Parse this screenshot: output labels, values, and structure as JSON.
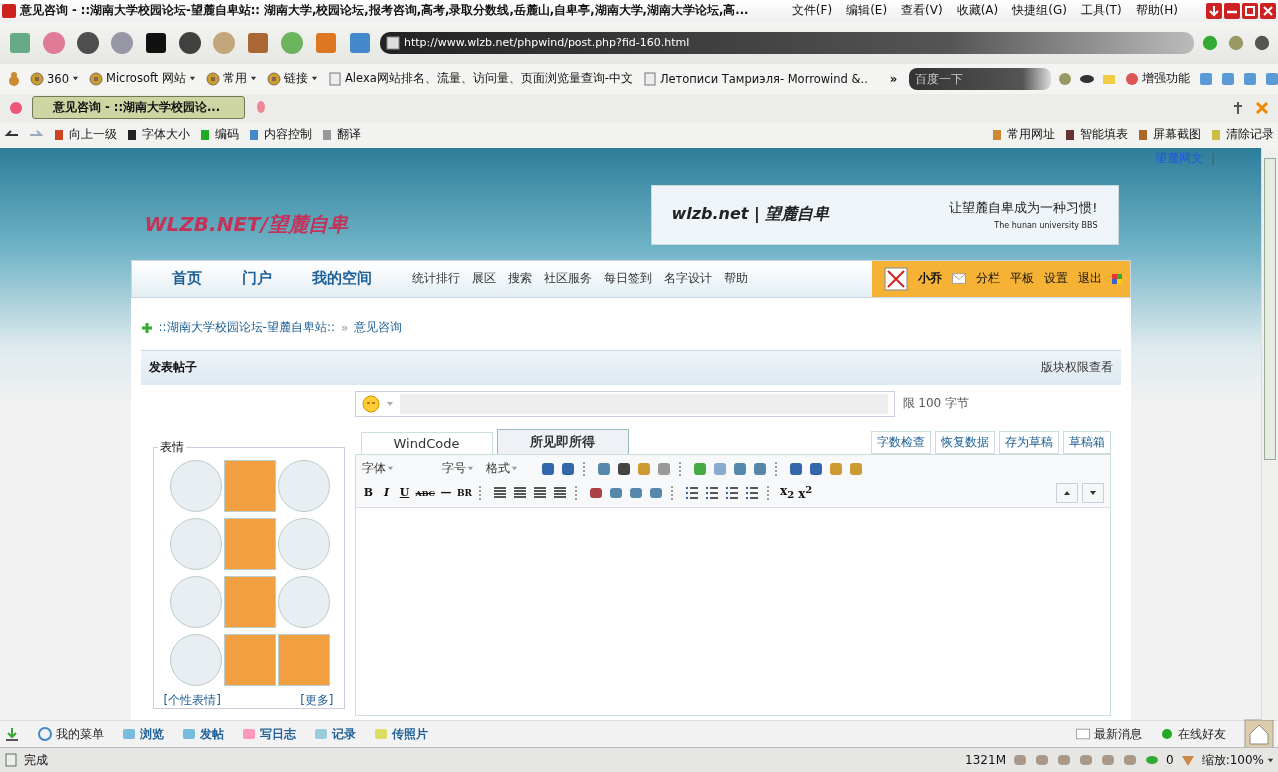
{
  "window": {
    "title": "意见咨询 - ::湖南大学校园论坛-望麓自卑站:: 湖南大学,校园论坛,报考咨询,高考,录取分数线,岳麓山,自卑亭,湖南大学,湖南大学论坛,高...",
    "menu": [
      "文件(F)",
      "编辑(E)",
      "查看(V)",
      "收藏(A)",
      "快捷组(G)",
      "工具(T)",
      "帮助(H)"
    ]
  },
  "address": {
    "url": "http://www.wlzb.net/phpwind/post.php?fid-160.html"
  },
  "bookmarks": [
    {
      "label": "360",
      "dropdown": true
    },
    {
      "label": "Microsoft 网站",
      "dropdown": true
    },
    {
      "label": "常用",
      "dropdown": true
    },
    {
      "label": "链接",
      "dropdown": true
    },
    {
      "label": "Alexa网站排名、流量、访问量、页面浏览量查询-中文",
      "dropdown": false
    },
    {
      "label": "Летописи Тамриэля- Morrowind &..",
      "dropdown": false
    }
  ],
  "more_bookmarks": "»",
  "search": {
    "placeholder": "百度一下"
  },
  "enhance_label": "增强功能",
  "tabs": [
    {
      "label": "意见咨询 - ::湖南大学校园论...",
      "selected": true
    }
  ],
  "nav_left": [
    "向上一级",
    "字体大小",
    "编码",
    "内容控制",
    "翻译"
  ],
  "nav_right": [
    "常用网址",
    "智能填表",
    "屏幕截图",
    "清除记录"
  ],
  "site": {
    "top_link": "望麓网文",
    "top_sep": "|",
    "logo_text": "WLZB.NET/望麓自卑",
    "banner": {
      "brand": "wlzb.net | 望麓自卑",
      "slogan": "让望麓自卑成为一种习惯!",
      "subtitle": "The hunan university BBS"
    },
    "main_nav": [
      "首页",
      "门户",
      "我的空间"
    ],
    "sub_nav": [
      "统计排行",
      "展区",
      "搜索",
      "社区服务",
      "每日签到",
      "名字设计",
      "帮助"
    ],
    "user": {
      "name": "小乔",
      "links": [
        "分栏",
        "平板",
        "设置",
        "退出"
      ]
    },
    "breadcrumb": [
      "::湖南大学校园论坛-望麓自卑站::",
      "»",
      "意见咨询"
    ],
    "section_title": "发表帖子",
    "section_link": "版块权限查看",
    "emoticons": {
      "legend": "表情",
      "custom": "[个性表情]",
      "more": "[更多]"
    },
    "title_limit": "限 100 字节",
    "editor_tabs": [
      {
        "label": "WindCode",
        "selected": false
      },
      {
        "label": "所见即所得",
        "selected": true
      }
    ],
    "editor_actions": [
      "字数检查",
      "恢复数据",
      "存为草稿",
      "草稿箱"
    ],
    "font_menus": [
      "字体",
      "字号",
      "格式"
    ],
    "format_buttons": [
      "B",
      "I",
      "U",
      "ABC",
      "—",
      "BR"
    ],
    "script_buttons": [
      "x$_{2}$",
      "x$^{2}$"
    ]
  },
  "bottom_bar": {
    "menu": "我的菜单",
    "items": [
      "浏览",
      "发帖",
      "写日志",
      "记录",
      "传照片"
    ],
    "messages": "最新消息",
    "friends": "在线好友"
  },
  "status_bar": {
    "status": "完成",
    "memory": "1321M",
    "count": "0",
    "zoom": "缩放:100%"
  }
}
